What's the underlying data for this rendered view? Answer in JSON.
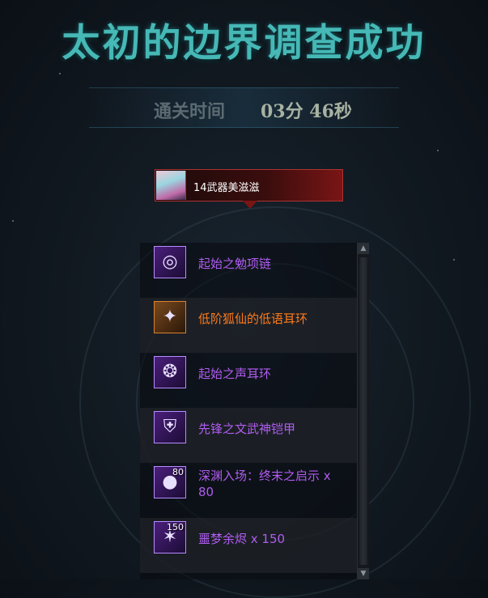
{
  "header": {
    "title": "太初的边界调查成功",
    "clear_time_label": "通关时间",
    "clear_time_value": "03分 46秒"
  },
  "character": {
    "name": "14武器美滋滋",
    "avatar": "character-portrait"
  },
  "rewards": [
    {
      "name": "起始之勉项链",
      "rarity_color": "#b05cf0",
      "icon": "necklace-icon",
      "count": ""
    },
    {
      "name": "低阶狐仙的低语耳环",
      "rarity_color": "#ff7a1a",
      "icon": "earring-icon",
      "count": ""
    },
    {
      "name": "起始之声耳环",
      "rarity_color": "#b05cf0",
      "icon": "earring-icon",
      "count": ""
    },
    {
      "name": "先锋之文武神铠甲",
      "rarity_color": "#b05cf0",
      "icon": "armor-icon",
      "count": ""
    },
    {
      "name": "深渊入场：终末之启示 x 80",
      "rarity_color": "#b05cf0",
      "icon": "orb-icon",
      "count": "80"
    },
    {
      "name": "噩梦余烬 x 150",
      "rarity_color": "#b05cf0",
      "icon": "ember-icon",
      "count": "150"
    }
  ],
  "colors": {
    "title": "#46b8b6",
    "epic": "#b05cf0",
    "legendary": "#ff7a1a"
  }
}
